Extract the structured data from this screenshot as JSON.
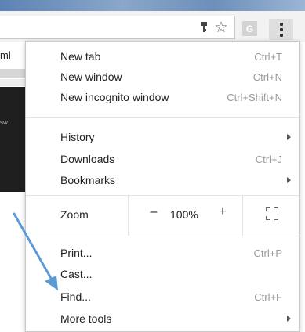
{
  "toolbar": {
    "extension_letter": "G",
    "accent_strip_color": "#6d8fb9"
  },
  "background_page": {
    "text": "ml",
    "small_text": "sw"
  },
  "menu": {
    "group1": [
      {
        "label": "New tab",
        "shortcut": "Ctrl+T"
      },
      {
        "label": "New window",
        "shortcut": "Ctrl+N"
      },
      {
        "label": "New incognito window",
        "shortcut": "Ctrl+Shift+N"
      }
    ],
    "group2": [
      {
        "label": "History",
        "submenu": true
      },
      {
        "label": "Downloads",
        "shortcut": "Ctrl+J"
      },
      {
        "label": "Bookmarks",
        "submenu": true
      }
    ],
    "zoom": {
      "label": "Zoom",
      "minus": "–",
      "value": "100%",
      "plus": "+",
      "fullscreen_icon": "fullscreen-icon"
    },
    "group3": [
      {
        "label": "Print...",
        "shortcut": "Ctrl+P"
      },
      {
        "label": "Cast..."
      },
      {
        "label": "Find...",
        "shortcut": "Ctrl+F"
      },
      {
        "label": "More tools",
        "submenu": true
      }
    ]
  },
  "annotation": {
    "arrow_color": "#5b9bd5"
  }
}
